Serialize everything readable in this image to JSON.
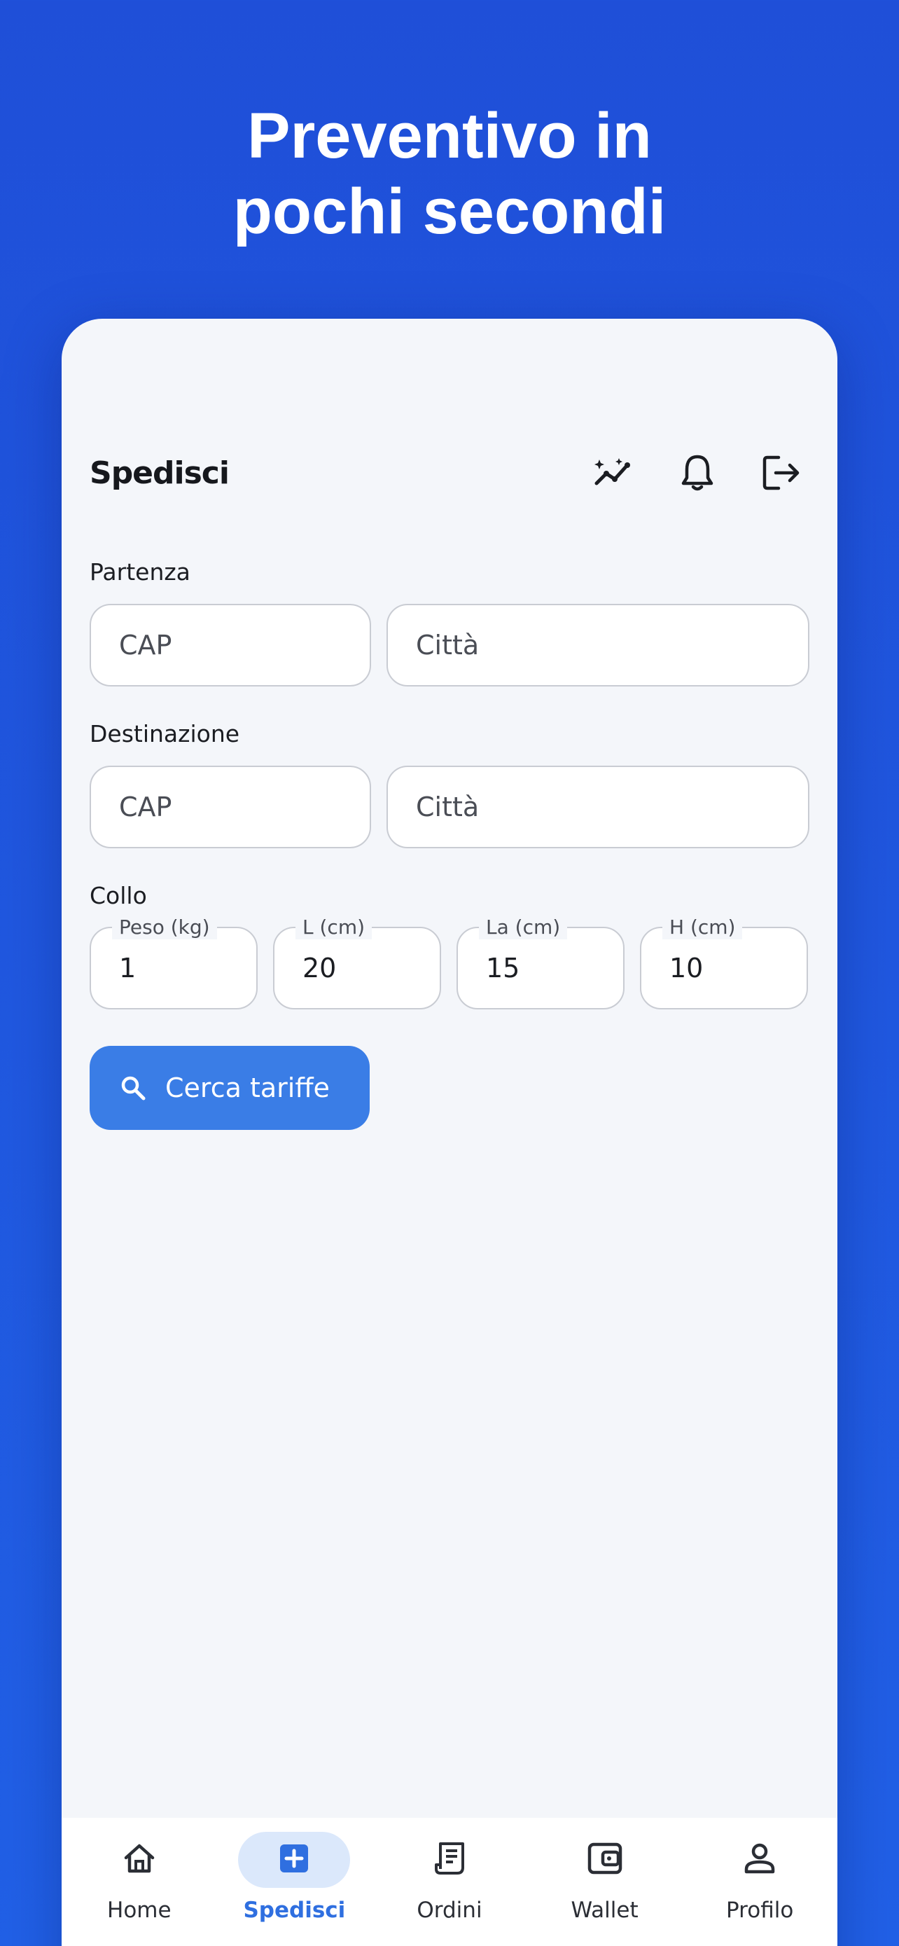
{
  "headline": {
    "line1": "Preventivo in",
    "line2": "pochi secondi"
  },
  "appbar": {
    "title": "Spedisci",
    "icons": [
      "chart-sparkle-icon",
      "bell-icon",
      "logout-icon"
    ]
  },
  "departure": {
    "label": "Partenza",
    "cap_placeholder": "CAP",
    "city_placeholder": "Città"
  },
  "destination": {
    "label": "Destinazione",
    "cap_placeholder": "CAP",
    "city_placeholder": "Città"
  },
  "package": {
    "label": "Collo",
    "weight": {
      "label": "Peso (kg)",
      "value": "1"
    },
    "length": {
      "label": "L (cm)",
      "value": "20"
    },
    "width": {
      "label": "La (cm)",
      "value": "15"
    },
    "height": {
      "label": "H (cm)",
      "value": "10"
    }
  },
  "search_button": {
    "label": "Cerca tariffe",
    "icon": "search-icon"
  },
  "tabbar": {
    "home": "Home",
    "ship": "Spedisci",
    "orders": "Ordini",
    "wallet": "Wallet",
    "profile": "Profilo",
    "active": "ship"
  },
  "colors": {
    "background": "#1f4fd8",
    "accent": "#3a7de6",
    "active_tab": "#2f6fe0",
    "active_tab_pill": "#dbe8fb"
  }
}
